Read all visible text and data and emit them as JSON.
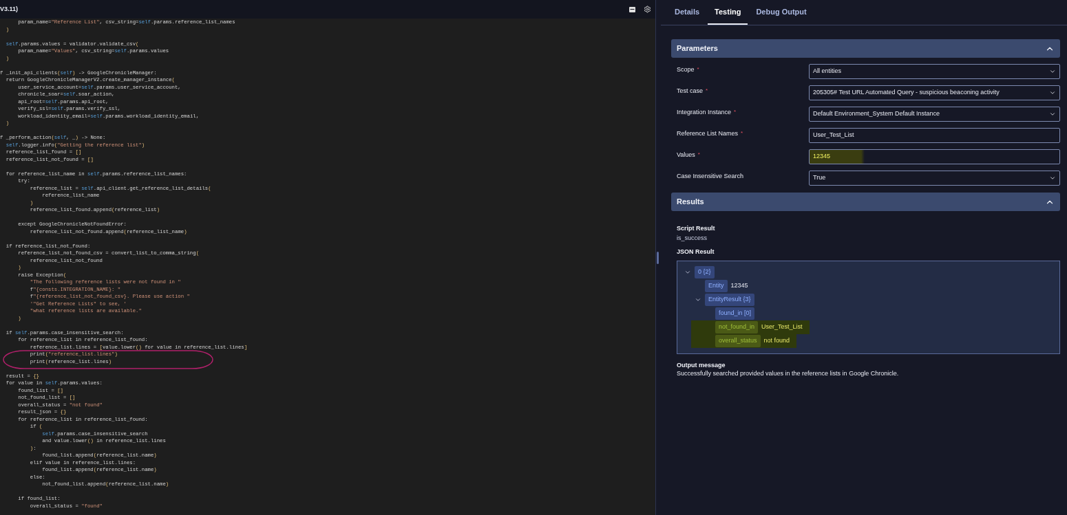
{
  "editor": {
    "title": "V3.11)",
    "lines": [
      {
        "text": "      param_name=\"Reference List\", csv_string=self.params.reference_list_names"
      },
      {
        "text": "  )"
      },
      {
        "text": "  self.params.values = validator.validate_csv(",
        "gap_before": true
      },
      {
        "text": "      param_name=\"Values\", csv_string=self.params.values"
      },
      {
        "text": "  )"
      },
      {
        "text": "f _init_api_clients(self) -> GoogleChronicleManager:",
        "gap_before": true
      },
      {
        "text": "  return GoogleChronicleManagerV2.create_manager_instance("
      },
      {
        "text": "      user_service_account=self.params.user_service_account,"
      },
      {
        "text": "      chronicle_soar=self.soar_action,"
      },
      {
        "text": "      api_root=self.params.api_root,"
      },
      {
        "text": "      verify_ssl=self.params.verify_ssl,"
      },
      {
        "text": "      workload_identity_email=self.params.workload_identity_email,"
      },
      {
        "text": "  )"
      },
      {
        "text": "f _perform_action(self, _) -> None:",
        "gap_before": true
      },
      {
        "text": "  self.logger.info(\"Getting the reference list\")"
      },
      {
        "text": "  reference_list_found = []"
      },
      {
        "text": "  reference_list_not_found = []"
      },
      {
        "text": "  for reference_list_name in self.params.reference_list_names:",
        "gap_before": true
      },
      {
        "text": "      try:"
      },
      {
        "text": "          reference_list = self.api_client.get_reference_list_details("
      },
      {
        "text": "              reference_list_name"
      },
      {
        "text": "          )"
      },
      {
        "text": "          reference_list_found.append(reference_list)"
      },
      {
        "text": "      except GoogleChronicleNotFoundError:",
        "gap_before": true
      },
      {
        "text": "          reference_list_not_found.append(reference_list_name)"
      },
      {
        "text": "  if reference_list_not_found:",
        "gap_before": true
      },
      {
        "text": "      reference_list_not_found_csv = convert_list_to_comma_string("
      },
      {
        "text": "          reference_list_not_found"
      },
      {
        "text": "      )"
      },
      {
        "text": "      raise Exception("
      },
      {
        "text": "          \"The following reference lists were not found in \""
      },
      {
        "text": "          f\"{consts.INTEGRATION_NAME}: \""
      },
      {
        "text": "          f\"{reference_list_not_found_csv}. Please use action \""
      },
      {
        "text": "          '\"Get Reference Lists\" to see, '"
      },
      {
        "text": "          \"what reference lists are available.\""
      },
      {
        "text": "      )"
      },
      {
        "text": "  if self.params.case_insensitive_search:",
        "gap_before": true
      },
      {
        "text": "      for reference_list in reference_list_found:"
      },
      {
        "text": "          reference_list.lines = [value.lower() for value in reference_list.lines]"
      },
      {
        "text": "          print(\"reference_list.lines\")"
      },
      {
        "text": "          print(reference_list.lines)"
      },
      {
        "text": "  result = {}",
        "gap_before": true
      },
      {
        "text": "  for value in self.params.values:"
      },
      {
        "text": "      found_list = []"
      },
      {
        "text": "      not_found_list = []"
      },
      {
        "text": "      overall_status = \"not found\""
      },
      {
        "text": "      result_json = {}"
      },
      {
        "text": "      for reference_list in reference_list_found:"
      },
      {
        "text": "          if ("
      },
      {
        "text": "              self.params.case_insensitive_search"
      },
      {
        "text": "              and value.lower() in reference_list.lines"
      },
      {
        "text": "          ):"
      },
      {
        "text": "              found_list.append(reference_list.name)"
      },
      {
        "text": "          elif value in reference_list.lines:"
      },
      {
        "text": "              found_list.append(reference_list.name)"
      },
      {
        "text": "          else:"
      },
      {
        "text": "              not_found_list.append(reference_list.name)"
      },
      {
        "text": "      if found_list:",
        "gap_before": true
      },
      {
        "text": "          overall_status = \"found\""
      }
    ]
  },
  "tabs": [
    {
      "label": "Details",
      "selected": false
    },
    {
      "label": "Testing",
      "selected": true
    },
    {
      "label": "Debug Output",
      "selected": false
    }
  ],
  "parameters": {
    "title": "Parameters",
    "expanded": true,
    "fields": [
      {
        "label": "Scope",
        "required_mark": "*",
        "kind": "select",
        "value": "All entities"
      },
      {
        "label": "Test case",
        "required_mark": "*",
        "kind": "select",
        "value": "205305# Test URL Automated Query - suspicious beaconing activity"
      },
      {
        "label": "Integration Instance",
        "required_mark": "*",
        "kind": "select",
        "value": "Default Environment_System Default Instance"
      },
      {
        "label": "Reference List Names",
        "required_mark": "*",
        "kind": "text",
        "value": "User_Test_List",
        "highlighted": false
      },
      {
        "label": "Values",
        "required_mark": "*",
        "kind": "text",
        "value": "12345",
        "highlighted": true
      },
      {
        "label": "Case Insensitive Search",
        "kind": "select",
        "value": "True"
      }
    ]
  },
  "results": {
    "title": "Results",
    "expanded": true,
    "script_result_label": "Script Result",
    "script_result": "is_success",
    "json_result_label": "JSON Result",
    "tree": [
      {
        "key": "0 {2}",
        "expanded": true,
        "highlighted": false,
        "children": [
          {
            "key": "Entity",
            "value": "12345",
            "highlighted": false
          },
          {
            "key": "EntityResult {3}",
            "expanded": true,
            "highlighted": false,
            "children": [
              {
                "key": "found_in [0]",
                "highlighted": false
              },
              {
                "key": "not_found_in",
                "value": "User_Test_List",
                "highlighted": true
              },
              {
                "key": "overall_status",
                "value": "not found",
                "highlighted": true
              }
            ]
          }
        ]
      }
    ],
    "output_label": "Output message",
    "output": "Successfully searched provided values in the reference lists in Google Chronicle."
  }
}
